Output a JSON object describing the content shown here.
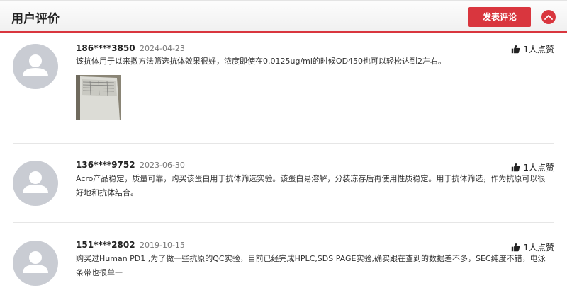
{
  "header": {
    "title": "用户评价",
    "post_button": "发表评论",
    "collapse_icon": "chevron-up-icon",
    "accent_color": "#d9363e"
  },
  "reviews": [
    {
      "user": "186****3850",
      "date": "2024-04-23",
      "likes": "1人点赞",
      "text": "该抗体用于以来撒方法筛选抗体效果很好，浓度即使在0.0125ug/ml的时候OD450也可以轻松达到2左右。",
      "has_photo": true
    },
    {
      "user": "136****9752",
      "date": "2023-06-30",
      "likes": "1人点赞",
      "text": "Acro产品稳定，质量可靠，购买该蛋白用于抗体筛选实验。该蛋白易溶解，分装冻存后再使用性质稳定。用于抗体筛选，作为抗原可以很好地和抗体结合。"
    },
    {
      "user": "151****2802",
      "date": "2019-10-15",
      "likes": "1人点赞",
      "text": "购买过Human PD1 ,为了做一些抗原的QC实验，目前已经完成HPLC,SDS PAGE实验,确实跟在查到的数据差不多，SEC纯度不错，电泳条带也很单一"
    }
  ]
}
